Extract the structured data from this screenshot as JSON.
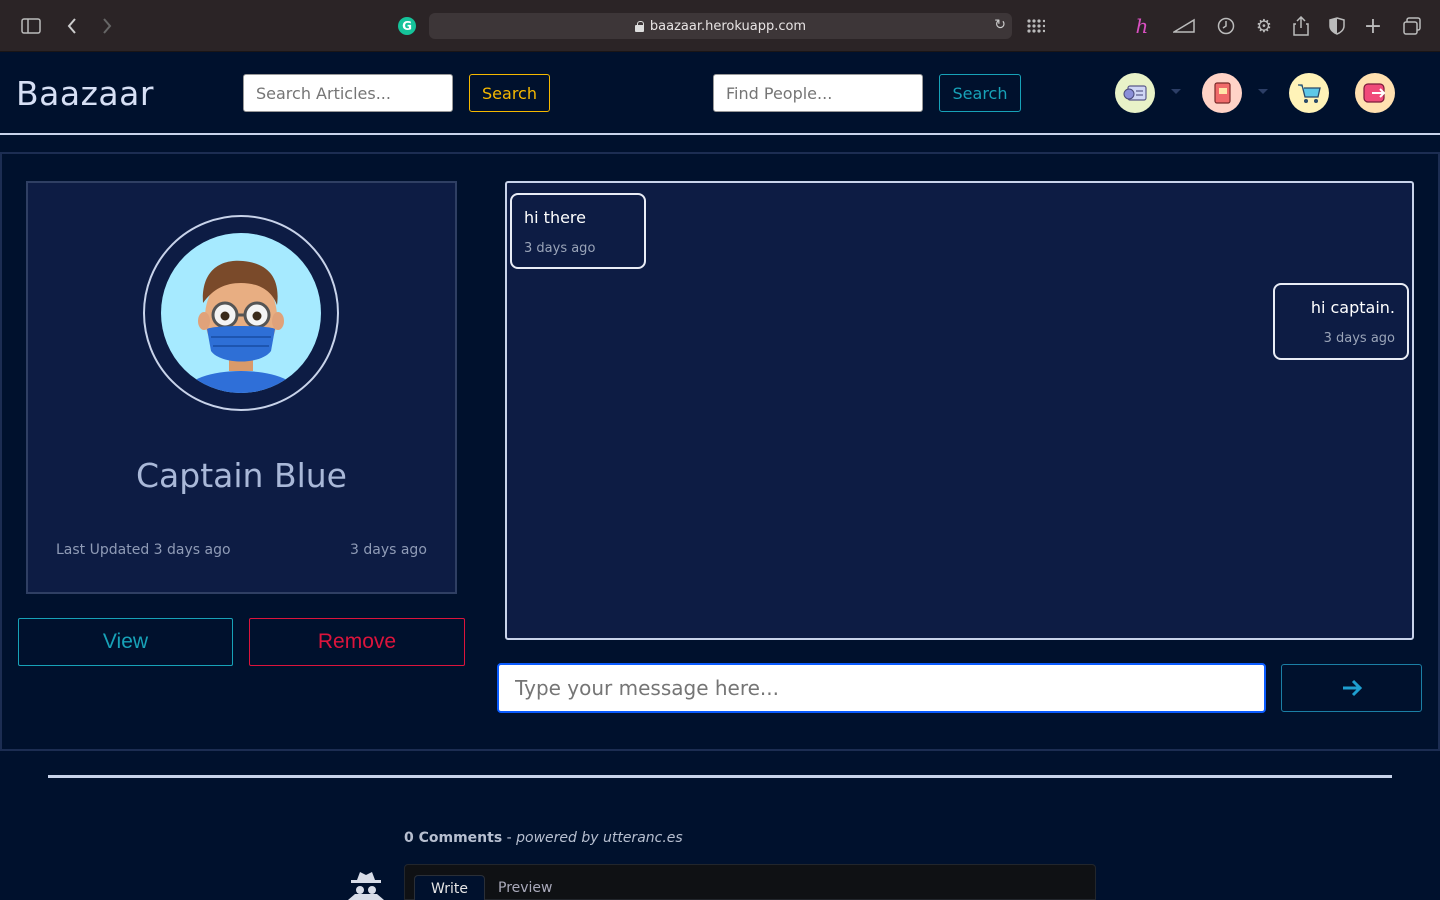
{
  "browser": {
    "url": "baazaar.herokuapp.com"
  },
  "header": {
    "brand": "Baazaar",
    "articles_search": {
      "placeholder": "Search Articles...",
      "button": "Search"
    },
    "people_search": {
      "placeholder": "Find People...",
      "button": "Search"
    },
    "icons": [
      "dashboard-icon",
      "notebook-icon",
      "cart-icon",
      "logout-icon"
    ]
  },
  "profile": {
    "name": "Captain Blue",
    "last_updated": "Last Updated 3 days ago",
    "created": "3 days ago",
    "view_button": "View",
    "remove_button": "Remove"
  },
  "chat": {
    "messages": [
      {
        "text": "hi there",
        "time": "3 days ago",
        "side": "left"
      },
      {
        "text": "hi captain.",
        "time": "3 days ago",
        "side": "right"
      }
    ],
    "input_placeholder": "Type your message here...",
    "send_icon": "arrow-right-icon"
  },
  "comments": {
    "count_label": "0 Comments",
    "separator": " - ",
    "powered": "powered by utteranc.es",
    "tabs": [
      "Write",
      "Preview"
    ]
  },
  "colors": {
    "background": "#00112d",
    "card": "#0d1c44",
    "accent_yellow": "#f5b800",
    "accent_cyan": "#17a2b8",
    "danger": "#dc143c"
  }
}
